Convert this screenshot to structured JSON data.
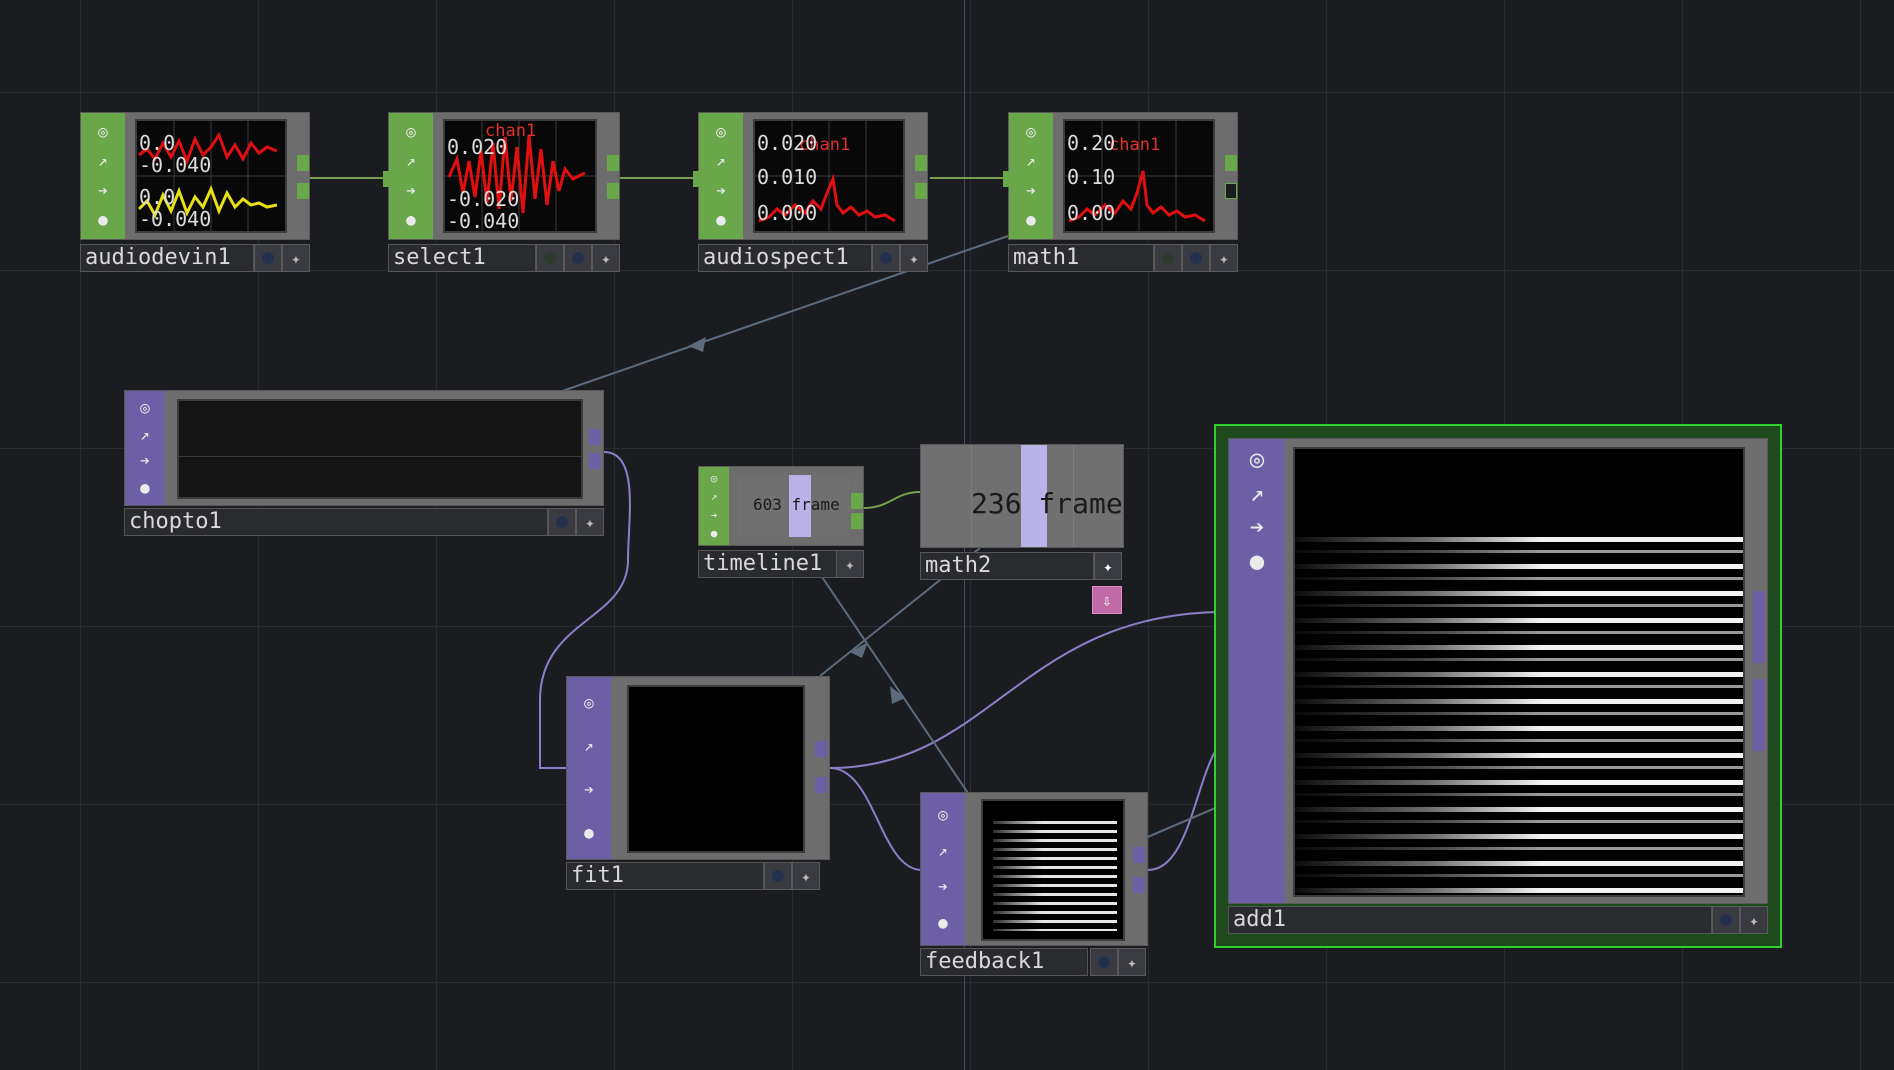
{
  "nodes": {
    "audiodevin1": {
      "name": "audiodevin1",
      "values": [
        "0.0",
        "-0.040",
        "0.0",
        "-0.040"
      ]
    },
    "select1": {
      "name": "select1",
      "values": [
        "0.020",
        "chan1",
        "-0.020",
        "-0.040"
      ]
    },
    "audiospect1": {
      "name": "audiospect1",
      "values": [
        "0.020",
        "0.010",
        "0.000"
      ],
      "channel": "chan1"
    },
    "math1": {
      "name": "math1",
      "values": [
        "0.20",
        "0.10",
        "0.00"
      ],
      "channel": "chan1"
    },
    "chopto1": {
      "name": "chopto1"
    },
    "timeline1": {
      "name": "timeline1",
      "frame": "603 frame"
    },
    "math2": {
      "name": "math2",
      "frame": "236 frame"
    },
    "fit1": {
      "name": "fit1"
    },
    "feedback1": {
      "name": "feedback1"
    },
    "add1": {
      "name": "add1"
    }
  },
  "colors": {
    "chop": "#6aa64a",
    "top": "#6d5fa6",
    "selected": "#2ed12e",
    "wire_chop": "#78a050",
    "wire_top": "#8a7fc8",
    "wire_export": "#5d6b7d"
  },
  "icons": [
    "viewer-icon",
    "bypass-icon",
    "display-icon",
    "lock-icon",
    "plus-icon",
    "clone-icon"
  ]
}
